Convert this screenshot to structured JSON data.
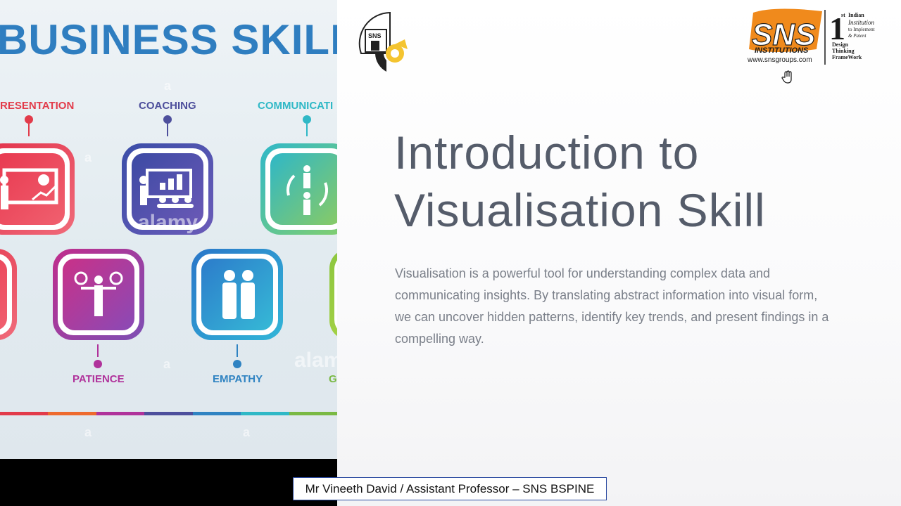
{
  "left_panel": {
    "heading": "BUSINESS SKILLS",
    "skills_top": [
      {
        "label": "RESENTATION",
        "color": "#e23b4a"
      },
      {
        "label": "COACHING",
        "color": "#4d4f9c"
      },
      {
        "label": "COMMUNICATI",
        "color": "#2fb8c6"
      }
    ],
    "skills_bottom": [
      {
        "label": "PATIENCE",
        "color": "#b0329b"
      },
      {
        "label": "EMPATHY",
        "color": "#2f83c2"
      },
      {
        "label": "G",
        "color": "#7ab944"
      }
    ],
    "watermark": "alamy",
    "watermark_letter": "a"
  },
  "header": {
    "emblem_text": "SNS",
    "logo_text": "SNS",
    "logo_subtitle": "INSTITUTIONS",
    "logo_url": "www.snsgroups.com",
    "badge_number": "1",
    "badge_super": "st",
    "badge_lines": [
      "Indian",
      "Institution",
      "to Implement",
      "& Patent"
    ],
    "badge_footer": [
      "Design",
      "Thinking",
      "FrameWork"
    ]
  },
  "content": {
    "title_line1": "Introduction to",
    "title_line2": "Visualisation Skill",
    "body": "Visualisation is a powerful tool for understanding complex data and communicating insights. By translating abstract information into visual form, we can uncover hidden patterns, identify key trends, and present findings in a compelling way."
  },
  "footer": {
    "presenter": "Mr Vineeth David / Assistant Professor – SNS BSPINE"
  },
  "colors": {
    "heading_blue": "#2f7ec0",
    "title_gray": "#555c6a",
    "body_gray": "#7a7f89",
    "sns_orange": "#f08a1c"
  }
}
